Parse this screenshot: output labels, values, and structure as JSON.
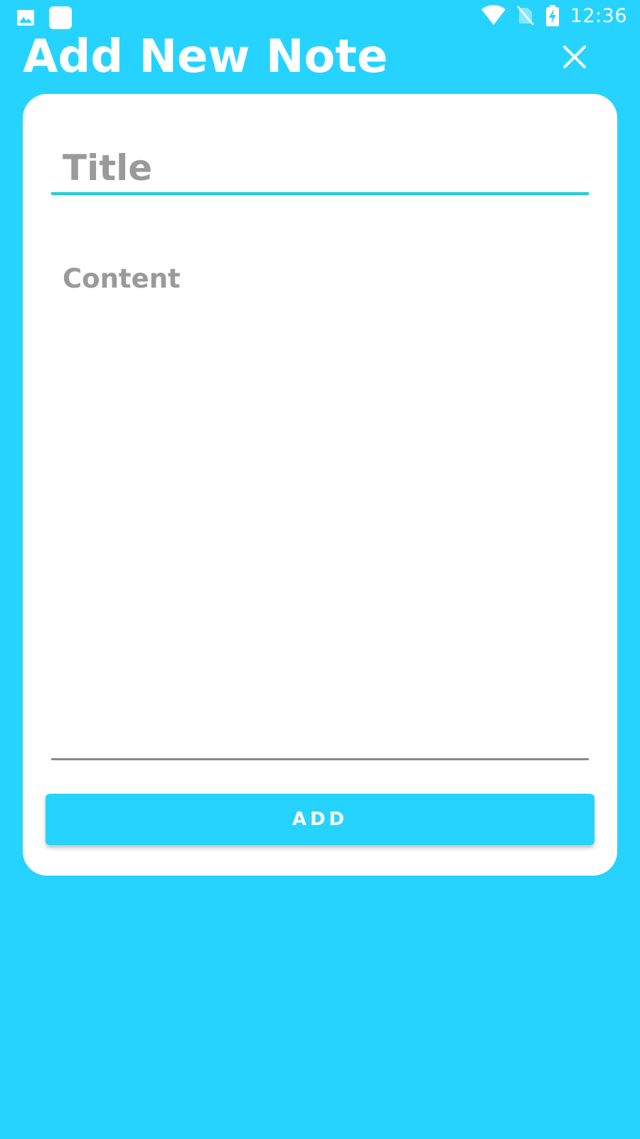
{
  "status_bar": {
    "time": "12:36",
    "icons": [
      "image-notification-icon",
      "app-notification-icon",
      "wifi-icon",
      "no-sim-icon",
      "battery-charging-icon"
    ]
  },
  "header": {
    "title": "Add New Note",
    "close_icon": "close-icon"
  },
  "form": {
    "title_placeholder": "Title",
    "title_value": "",
    "content_placeholder": "Content",
    "content_value": "",
    "submit_label": "ADD"
  },
  "colors": {
    "background": "#26d3ff",
    "card": "#ffffff",
    "title_underline": "#1fd0cf",
    "content_underline": "#8a8a8a",
    "placeholder": "#9a9a9a"
  }
}
